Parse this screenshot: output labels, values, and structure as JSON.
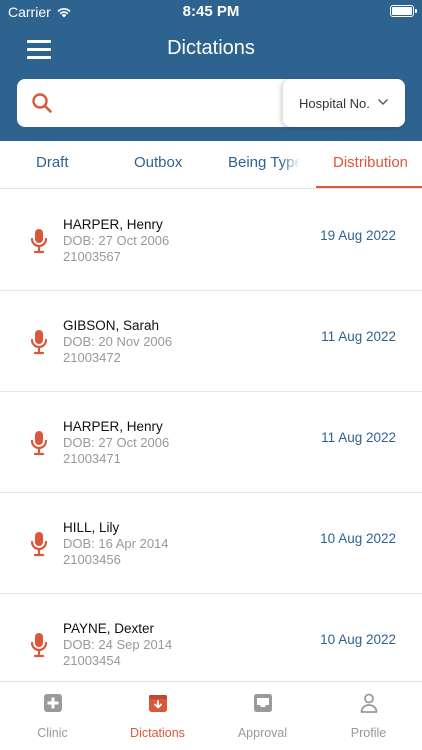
{
  "status_bar": {
    "carrier": "Carrier",
    "time": "8:45 PM"
  },
  "header": {
    "title": "Dictations"
  },
  "search": {
    "placeholder": "",
    "value": "",
    "filter_label": "Hospital No."
  },
  "tabs": [
    {
      "label": "Draft"
    },
    {
      "label": "Outbox"
    },
    {
      "label": "Being Typed"
    },
    {
      "label": "Distribution"
    }
  ],
  "active_tab": "Distribution",
  "dictations": [
    {
      "name": "HARPER, Henry",
      "dob": "DOB: 27 Oct 2006",
      "hospital_no": "21003567",
      "date": "19 Aug 2022"
    },
    {
      "name": "GIBSON, Sarah",
      "dob": "DOB: 20 Nov 2006",
      "hospital_no": "21003472",
      "date": "11 Aug 2022"
    },
    {
      "name": "HARPER, Henry",
      "dob": "DOB: 27 Oct 2006",
      "hospital_no": "21003471",
      "date": "11 Aug 2022"
    },
    {
      "name": "HILL, Lily",
      "dob": "DOB: 16 Apr 2014",
      "hospital_no": "21003456",
      "date": "10 Aug 2022"
    },
    {
      "name": "PAYNE, Dexter",
      "dob": "DOB: 24 Sep 2014",
      "hospital_no": "21003454",
      "date": "10 Aug 2022"
    }
  ],
  "tabbar": [
    {
      "label": "Clinic",
      "icon": "medical-cross-icon"
    },
    {
      "label": "Dictations",
      "icon": "inbox-download-icon"
    },
    {
      "label": "Approval",
      "icon": "tray-icon"
    },
    {
      "label": "Profile",
      "icon": "person-icon"
    }
  ],
  "active_tabbar": "Dictations",
  "colors": {
    "header": "#2e6390",
    "accent": "#d9583a",
    "link": "#2e6390",
    "muted": "#999999"
  }
}
